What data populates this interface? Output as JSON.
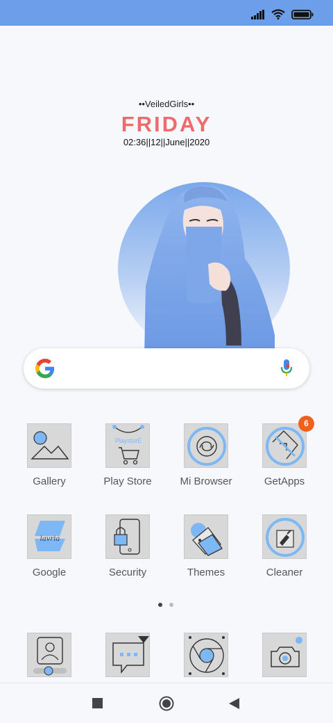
{
  "status_bar": {
    "icons": [
      "signal-icon",
      "wifi-icon",
      "battery-icon"
    ],
    "color": "#6d9eea"
  },
  "widget": {
    "subtitle": "••VeiledGirls••",
    "day": "FRIDAY",
    "date_line": "02:36||12||June||2020"
  },
  "search": {
    "icons": [
      "google-g-icon",
      "mic-icon"
    ]
  },
  "apps": [
    {
      "label": "Gallery",
      "icon": "gallery-icon"
    },
    {
      "label": "Play Store",
      "icon": "play-store-icon",
      "tile_text": "PlaystorE"
    },
    {
      "label": "Mi Browser",
      "icon": "browser-icon"
    },
    {
      "label": "GetApps",
      "icon": "getapps-icon",
      "badge": "6"
    },
    {
      "label": "Google",
      "icon": "google-app-icon",
      "tile_text": "lavria"
    },
    {
      "label": "Security",
      "icon": "security-icon"
    },
    {
      "label": "Themes",
      "icon": "themes-icon"
    },
    {
      "label": "Cleaner",
      "icon": "cleaner-icon"
    }
  ],
  "dock": [
    {
      "icon": "phone-contacts-icon"
    },
    {
      "icon": "messages-icon"
    },
    {
      "icon": "chrome-icon"
    },
    {
      "icon": "camera-icon"
    }
  ],
  "page_indicator": {
    "count": 2,
    "active": 1
  },
  "nav": {
    "icons": [
      "recents-icon",
      "home-icon",
      "back-icon"
    ]
  },
  "colors": {
    "accent": "#6d9eea",
    "day_text": "#ee6b6b",
    "badge": "#f0611c",
    "icon_blue": "#7db8f5"
  }
}
